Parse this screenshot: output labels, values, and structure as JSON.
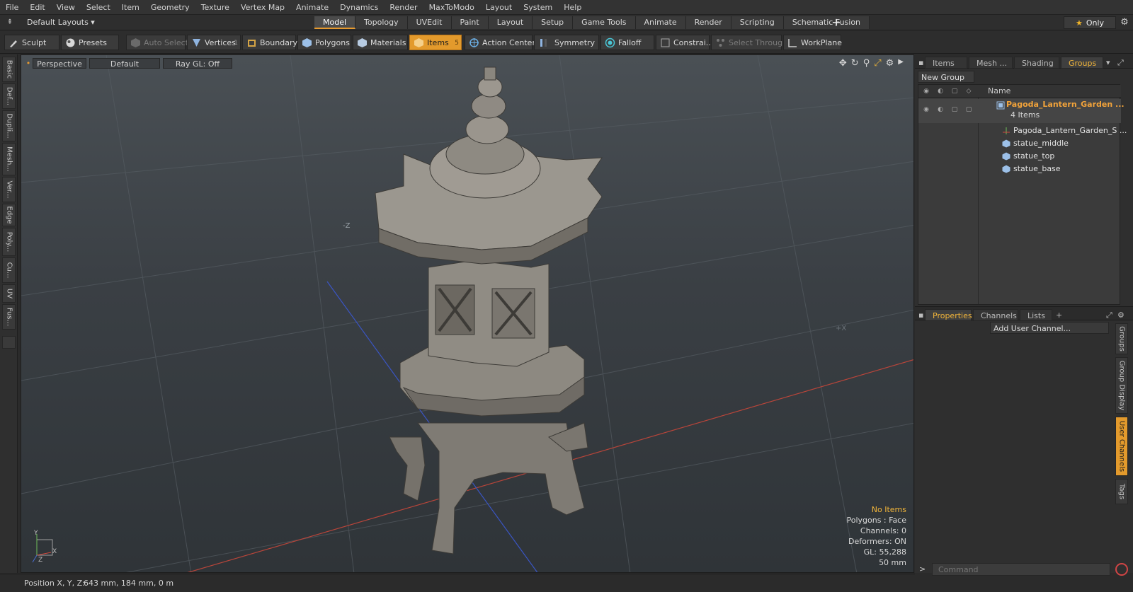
{
  "menu": [
    "File",
    "Edit",
    "View",
    "Select",
    "Item",
    "Geometry",
    "Texture",
    "Vertex Map",
    "Animate",
    "Dynamics",
    "Render",
    "MaxToModo",
    "Layout",
    "System",
    "Help"
  ],
  "layout": {
    "selector": "Default Layouts ▾",
    "tabs": [
      "Model",
      "Topology",
      "UVEdit",
      "Paint",
      "Layout",
      "Setup",
      "Game Tools",
      "Animate",
      "Render",
      "Scripting",
      "Schematic Fusion"
    ],
    "active_tab": "Model",
    "only_label": "Only"
  },
  "toolbar": {
    "sculpt": "Sculpt",
    "presets": "Presets",
    "auto_select": "Auto Select",
    "vertices": "Vertices",
    "vertices_count": "1",
    "boundary": "Boundary",
    "polygons": "Polygons",
    "materials": "Materials",
    "items": "Items",
    "items_count": "5",
    "action_center": "Action Center",
    "symmetry": "Symmetry",
    "falloff": "Falloff",
    "constraints": "Constrai...",
    "select_through": "Select Through",
    "workplane": "WorkPlane"
  },
  "left_tabs": [
    "Basic",
    "Def...",
    "Dupli...",
    "Mesh...",
    "Ver...",
    "Edge",
    "Poly...",
    "Cu...",
    "UV",
    "Fus..."
  ],
  "viewport": {
    "view_mode": "Perspective",
    "shading": "Default",
    "raygl": "Ray GL: Off",
    "info": {
      "selection": "No Items",
      "polygons": "Polygons : Face",
      "channels": "Channels: 0",
      "deformers": "Deformers: ON",
      "gl": "GL: 55,288",
      "grid": "50 mm"
    },
    "axis_labels": {
      "y": "Y",
      "x": "X",
      "z": "Z"
    }
  },
  "right_panel": {
    "top_tabs": [
      "Items",
      "Mesh ...",
      "Shading",
      "Groups"
    ],
    "active_top_tab": "Groups",
    "new_group": "New Group",
    "list_header": "Name",
    "group_name": "Pagoda_Lantern_Garden ...",
    "group_count": "4 Items",
    "children": [
      "Pagoda_Lantern_Garden_S ...",
      "statue_middle",
      "statue_top",
      "statue_base"
    ],
    "bottom_tabs": [
      "Properties",
      "Channels",
      "Lists"
    ],
    "active_bottom_tab": "Properties",
    "add_user_channel": "Add User Channel...",
    "side_tabs": [
      "Groups",
      "Group Display",
      "User Channels",
      "Tags"
    ],
    "active_side_tab": "User Channels",
    "command_placeholder": "Command"
  },
  "status": {
    "label": "Position X, Y, Z:",
    "value": "643 mm, 184 mm, 0 m"
  },
  "colors": {
    "accent": "#e39a2c",
    "highlight_text": "#f2b53a",
    "grid_line": "#5a6166",
    "axis_x": "#c0392b",
    "axis_z": "#3455c8"
  }
}
